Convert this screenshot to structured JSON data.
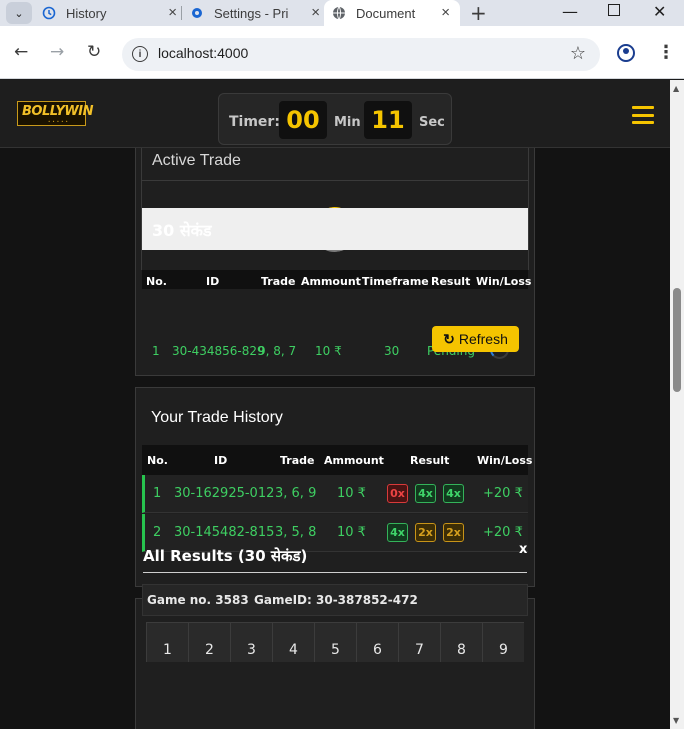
{
  "browser": {
    "tabs": [
      {
        "label": "History",
        "active": false
      },
      {
        "label": "Settings - Pri",
        "active": false
      },
      {
        "label": "Document",
        "active": true
      }
    ],
    "url": "localhost:4000"
  },
  "header": {
    "logo_text": "BOLLYWIN",
    "timer_label": "Timer:",
    "minutes": "00",
    "min_label": "Min",
    "seconds": "11",
    "sec_label": "Sec"
  },
  "active_trade": {
    "title": "Active Trade",
    "columns": [
      "No.",
      "ID",
      "Trade",
      "Ammount",
      "Timeframe",
      "Result",
      "Win/Loss"
    ],
    "group_label": "30 सेकंड",
    "rows": [
      {
        "no": "1",
        "id": "30-434856-829",
        "trade": "9, 8, 7",
        "amount": "10 ₹",
        "timeframe": "30",
        "result": "Pending"
      }
    ]
  },
  "trade_history": {
    "title": "Your Trade History",
    "refresh_label": "Refresh",
    "columns": [
      "No.",
      "ID",
      "Trade",
      "Ammount",
      "Result",
      "Win/Loss"
    ],
    "rows": [
      {
        "no": "1",
        "id": "30-162925-012",
        "trade": "3, 6, 9",
        "amount": "10 ₹",
        "results": [
          "0x",
          "4x",
          "4x"
        ],
        "winloss": "+20 ₹"
      },
      {
        "no": "2",
        "id": "30-145482-815",
        "trade": "3, 5, 8",
        "amount": "10 ₹",
        "results": [
          "4x",
          "2x",
          "2x"
        ],
        "winloss": "+20 ₹"
      }
    ]
  },
  "all_results": {
    "title": "All Results (30 सेकंड)",
    "close_label": "x",
    "game_no_label": "Game no. 3583",
    "game_id_label": "GameID: 30-387852-472",
    "numbers": [
      "1",
      "2",
      "3",
      "4",
      "5",
      "6",
      "7",
      "8",
      "9"
    ]
  }
}
